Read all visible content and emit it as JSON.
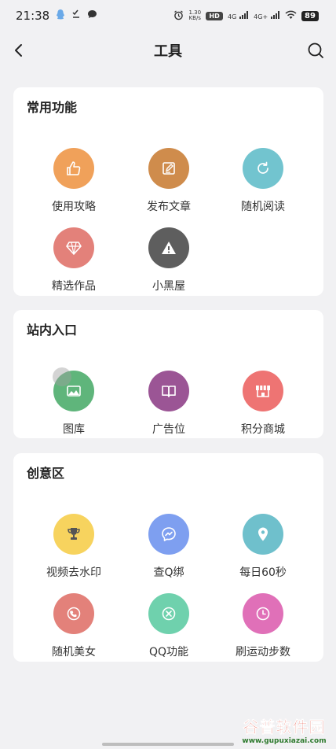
{
  "status_bar": {
    "time": "21:38",
    "net_speed_top": "1.30",
    "net_speed_bottom": "KB/s",
    "hd_badge": "HD",
    "signal1": "4G",
    "signal2": "4G+",
    "battery": "89"
  },
  "header": {
    "title": "工具"
  },
  "sections": [
    {
      "title": "常用功能",
      "items": [
        {
          "label": "使用攻略",
          "icon": "thumbs-up-icon",
          "color": "#f0a15a"
        },
        {
          "label": "发布文章",
          "icon": "edit-icon",
          "color": "#cf8c4c"
        },
        {
          "label": "随机阅读",
          "icon": "refresh-icon",
          "color": "#72c4cf"
        },
        {
          "label": "精选作品",
          "icon": "diamond-icon",
          "color": "#e3817a"
        },
        {
          "label": "小黑屋",
          "icon": "warning-icon",
          "color": "#5e5e5e"
        }
      ]
    },
    {
      "title": "站内入口",
      "items": [
        {
          "label": "图库",
          "icon": "image-icon",
          "color": "#5fb57b"
        },
        {
          "label": "广告位",
          "icon": "book-icon",
          "color": "#9b5595"
        },
        {
          "label": "积分商城",
          "icon": "store-icon",
          "color": "#ee7473"
        }
      ]
    },
    {
      "title": "创意区",
      "items": [
        {
          "label": "视频去水印",
          "icon": "trophy-icon",
          "color": "#f7d35e"
        },
        {
          "label": "查Q绑",
          "icon": "messenger-icon",
          "color": "#7e9ff0"
        },
        {
          "label": "每日60秒",
          "icon": "location-pin-icon",
          "color": "#6fc0cc"
        },
        {
          "label": "随机美女",
          "icon": "phone-icon",
          "color": "#e3817a"
        },
        {
          "label": "QQ功能",
          "icon": "close-circle-icon",
          "color": "#6fd1ad"
        },
        {
          "label": "刷运动步数",
          "icon": "clock-icon",
          "color": "#e070b8"
        }
      ]
    }
  ],
  "watermark": {
    "main": "谷普软件园",
    "sub": "www.gupuxiazai.com"
  }
}
